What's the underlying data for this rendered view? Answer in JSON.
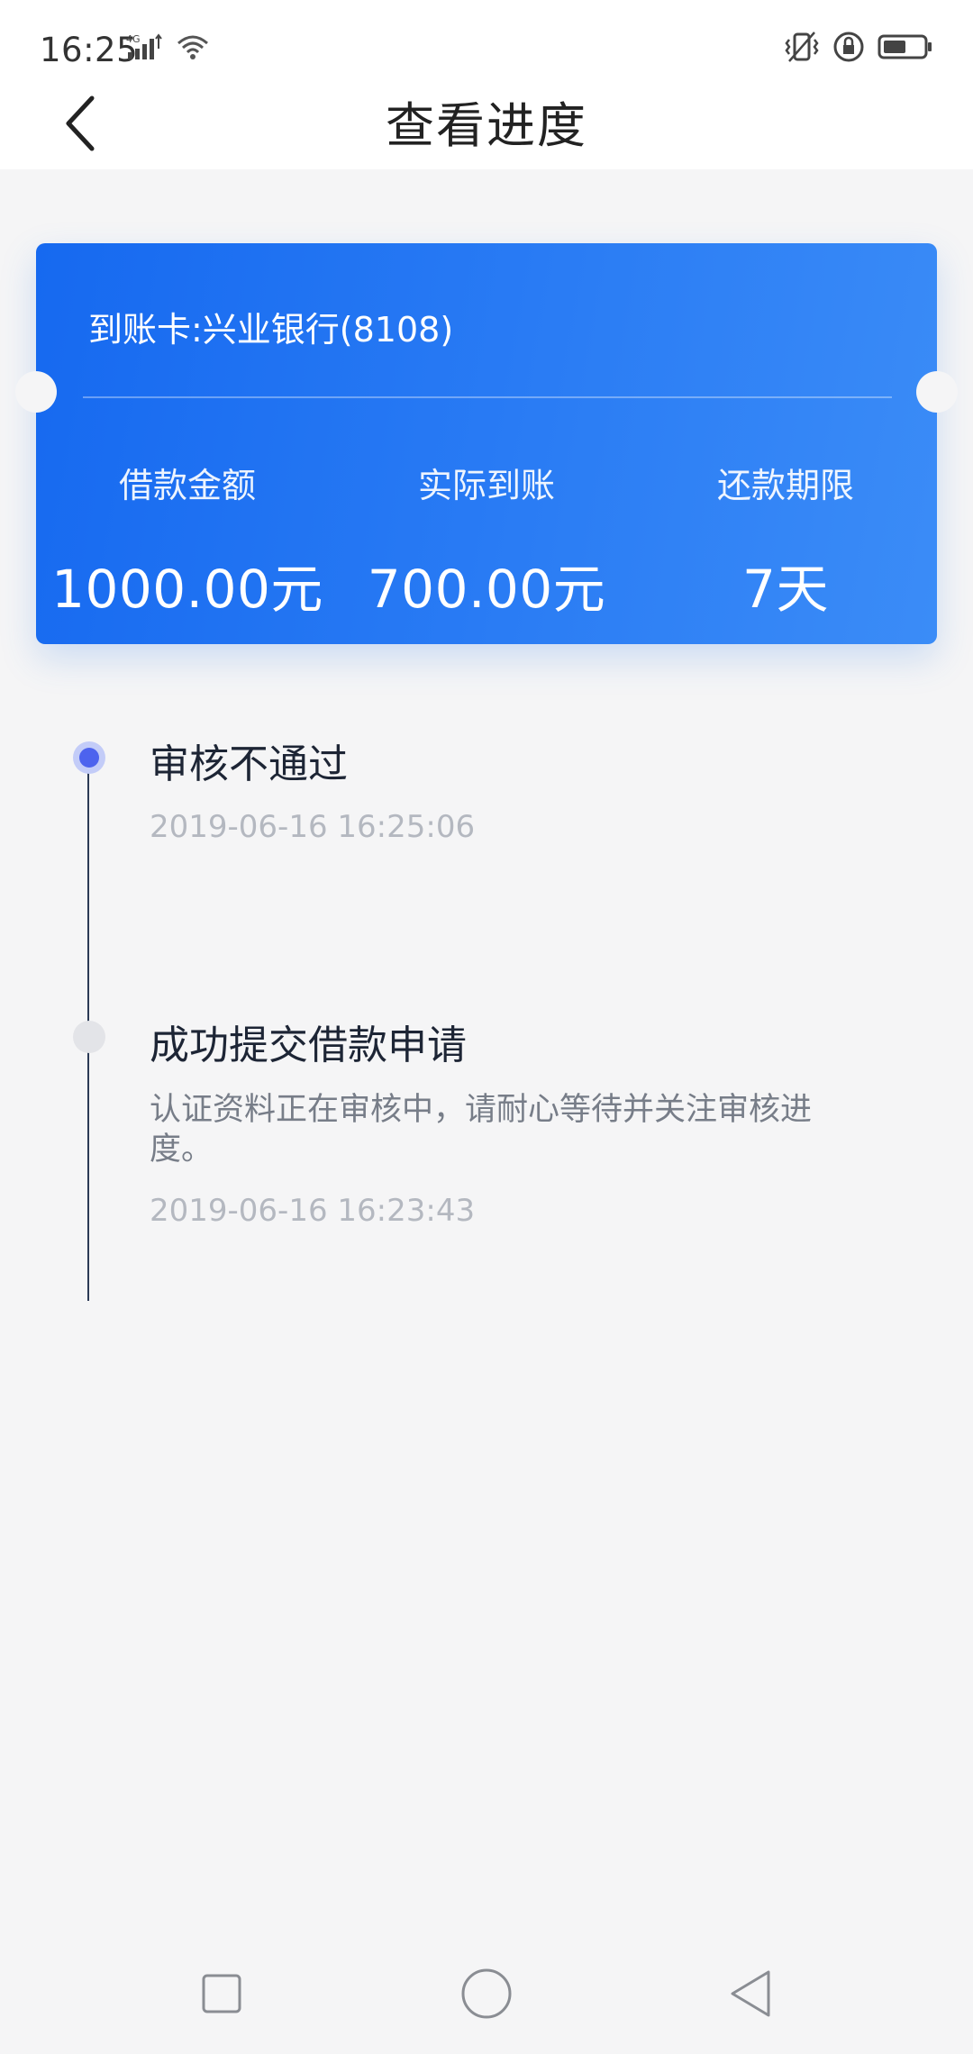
{
  "status_bar": {
    "time": "16:25",
    "network": "4G",
    "icons": [
      "signal-icon",
      "wifi-icon",
      "vibrate-icon",
      "rotation-lock-icon",
      "battery-icon"
    ]
  },
  "header": {
    "back_icon": "chevron-left-icon",
    "title": "查看进度"
  },
  "card": {
    "account": "到账卡:兴业银行(8108)",
    "stats": [
      {
        "label": "借款金额",
        "value": "1000.00元"
      },
      {
        "label": "实际到账",
        "value": "700.00元"
      },
      {
        "label": "还款期限",
        "value": "7天"
      }
    ],
    "colors": {
      "gradient_start": "#1669f0",
      "gradient_end": "#3b8cf7"
    }
  },
  "timeline": [
    {
      "title": "审核不通过",
      "description": "",
      "time": "2019-06-16 16:25:06",
      "active": true
    },
    {
      "title": "成功提交借款申请",
      "description": "认证资料正在审核中，请耐心等待并关注审核进度。",
      "time": "2019-06-16 16:23:43",
      "active": false
    }
  ],
  "nav": {
    "icons": [
      "square-recent-icon",
      "circle-home-icon",
      "triangle-back-icon"
    ]
  }
}
